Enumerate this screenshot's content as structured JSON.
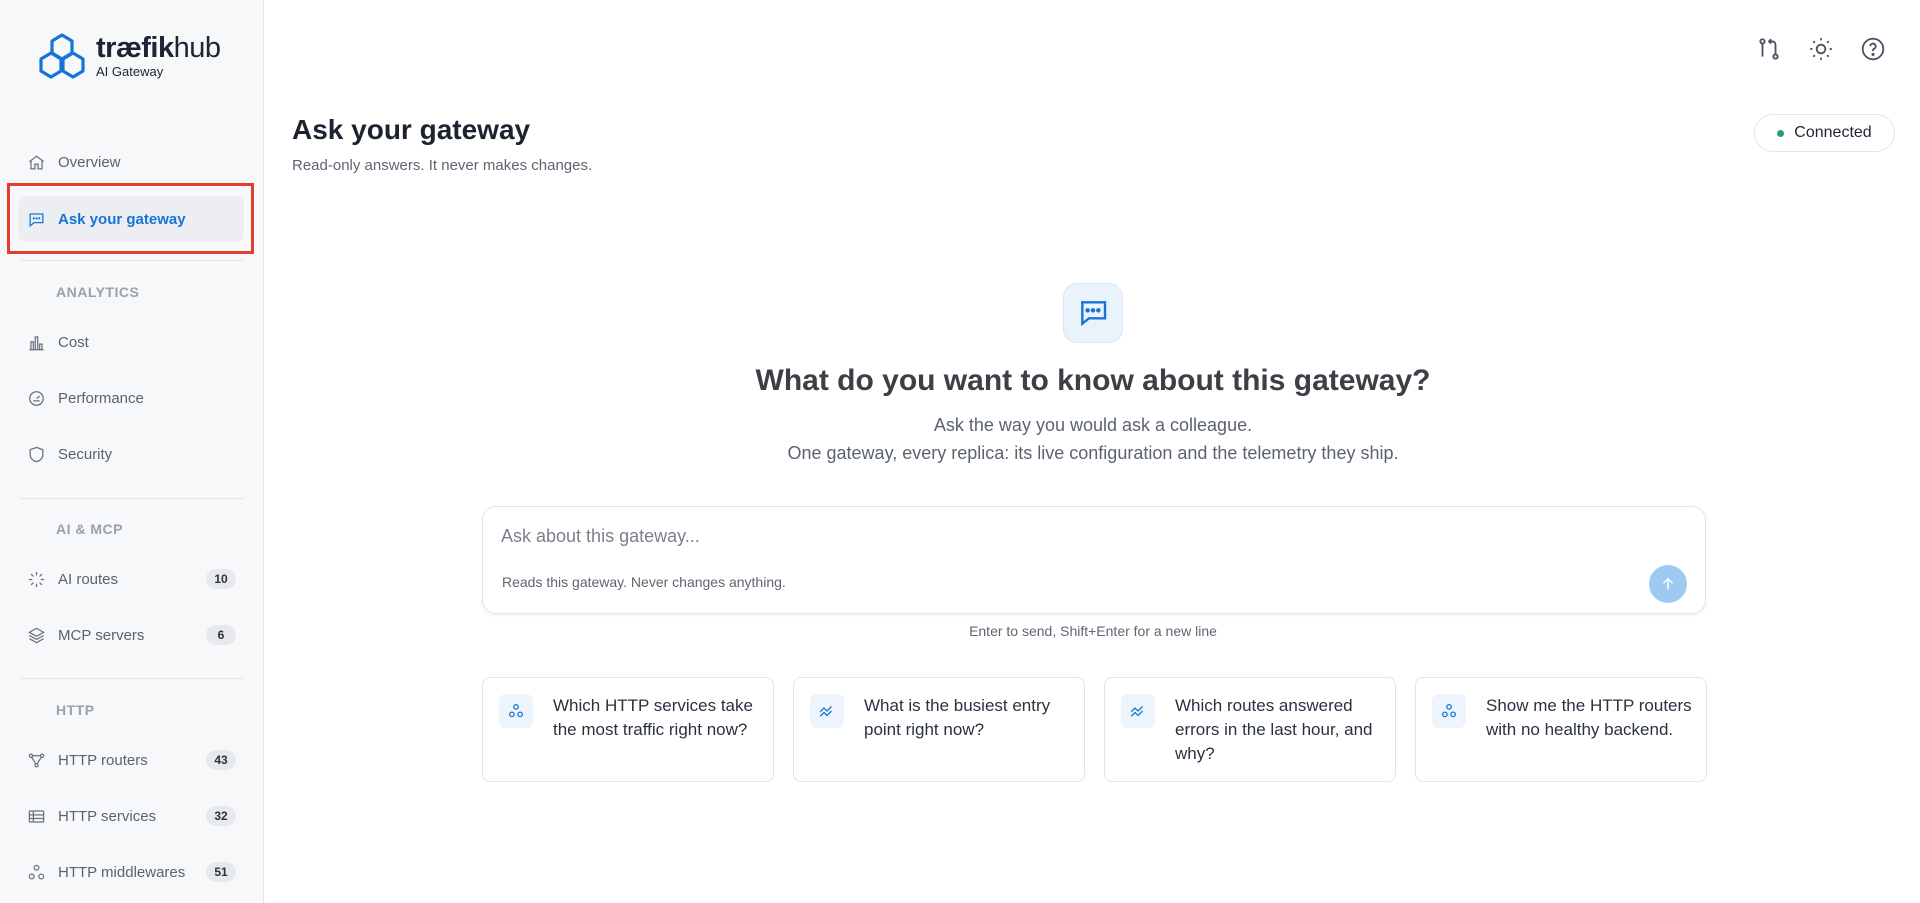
{
  "brand": {
    "name_part1": "træfik",
    "name_part2": "hub",
    "product": "AI Gateway",
    "accent_color": "#1574d4"
  },
  "sidebar": {
    "top_items": [
      {
        "label": "Overview",
        "icon": "home-icon"
      },
      {
        "label": "Ask your gateway",
        "icon": "chat-icon",
        "active": true
      }
    ],
    "sections": [
      {
        "label": "ANALYTICS",
        "items": [
          {
            "label": "Cost",
            "icon": "bar-chart-icon"
          },
          {
            "label": "Performance",
            "icon": "gauge-icon"
          },
          {
            "label": "Security",
            "icon": "shield-icon"
          }
        ]
      },
      {
        "label": "AI & MCP",
        "items": [
          {
            "label": "AI routes",
            "icon": "spinner-icon",
            "count": "10"
          },
          {
            "label": "MCP servers",
            "icon": "layers-icon",
            "count": "6"
          }
        ]
      },
      {
        "label": "HTTP",
        "items": [
          {
            "label": "HTTP routers",
            "icon": "router-icon",
            "count": "43"
          },
          {
            "label": "HTTP services",
            "icon": "list-icon",
            "count": "32"
          },
          {
            "label": "HTTP middlewares",
            "icon": "nodes-icon",
            "count": "51"
          }
        ]
      }
    ]
  },
  "topbar": {
    "icons": [
      "git-compare-icon",
      "sun-icon",
      "help-icon"
    ]
  },
  "header": {
    "title": "Ask your gateway",
    "subtitle": "Read-only answers. It never makes changes.",
    "status": "Connected",
    "status_color": "#26a269"
  },
  "hero": {
    "title": "What do you want to know about this gateway?",
    "line1": "Ask the way you would ask a colleague.",
    "line2": "One gateway, every replica: its live configuration and the telemetry they ship."
  },
  "composer": {
    "placeholder": "Ask about this gateway...",
    "value": "",
    "note": "Reads this gateway. Never changes anything.",
    "hint": "Enter to send, Shift+Enter for a new line"
  },
  "suggestions": [
    {
      "text": "Which HTTP services take the most traffic right now?",
      "icon": "nodes-icon"
    },
    {
      "text": "What is the busiest entry point right now?",
      "icon": "trend-icon"
    },
    {
      "text": "Which routes answered errors in the last hour, and why?",
      "icon": "trend-icon"
    },
    {
      "text": "Show me the HTTP routers with no healthy backend.",
      "icon": "nodes-icon"
    }
  ]
}
